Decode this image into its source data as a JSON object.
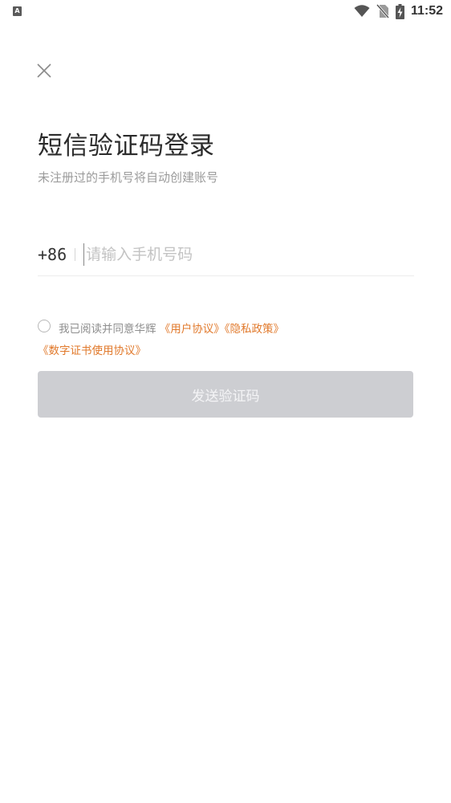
{
  "status_bar": {
    "app_badge": "A",
    "time": "11:52",
    "icons": [
      "wifi-icon",
      "no-sim-icon",
      "battery-charging-icon"
    ]
  },
  "page": {
    "close_icon": "close-icon",
    "title": "短信验证码登录",
    "subtitle": "未注册过的手机号将自动创建账号"
  },
  "phone": {
    "country_code": "+86",
    "placeholder": "请输入手机号码",
    "value": ""
  },
  "agreement": {
    "prefix": "我已阅读并同意华辉 ",
    "links": [
      "《用户协议》",
      "《隐私政策》",
      "《数字证书使用协议》"
    ],
    "checked": false
  },
  "send_button": {
    "label": "发送验证码"
  },
  "colors": {
    "link": "#e1792b",
    "button_disabled_bg": "#cdced2",
    "title": "#2b2b2b"
  }
}
